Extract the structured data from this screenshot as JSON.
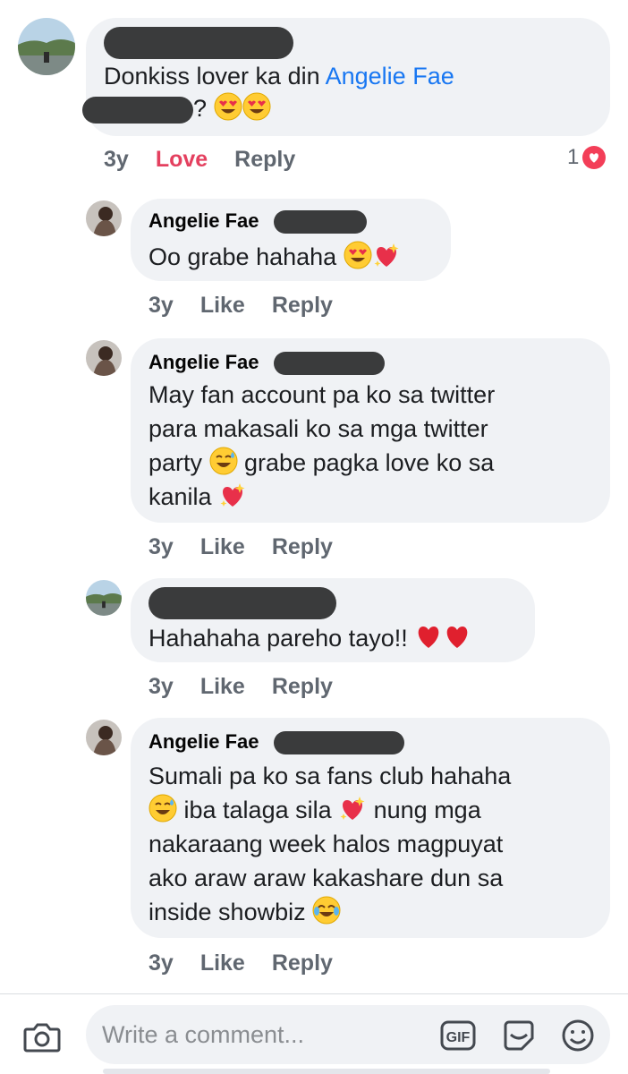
{
  "colors": {
    "bubble": "#f0f2f5",
    "love": "#e4405f",
    "link": "#1877f2",
    "meta": "#606770"
  },
  "composer": {
    "placeholder": "Write a comment...",
    "gif_label": "GIF"
  },
  "comments": [
    {
      "author": "",
      "text_line1_prefix": "Donkiss lover ka din ",
      "mention": "Angelie Fae",
      "text_line2_suffix": "? ",
      "emojis": [
        "heart-eyes",
        "heart-eyes"
      ],
      "time": "3y",
      "reaction_label": "Love",
      "reply_label": "Reply",
      "reaction_count": "1",
      "reaction_icon": "heart-icon"
    },
    {
      "author": "Angelie Fae",
      "lines": [
        "Oo grabe hahaha "
      ],
      "emojis": [
        "heart-eyes",
        "sparkling-heart"
      ],
      "time": "3y",
      "like_label": "Like",
      "reply_label": "Reply"
    },
    {
      "author": "Angelie Fae",
      "lines": [
        "May fan account pa ko sa twitter",
        "para makasali ko sa mga twitter",
        "party ",
        " grabe pagka love ko sa",
        "kanila "
      ],
      "time": "3y",
      "like_label": "Like",
      "reply_label": "Reply"
    },
    {
      "author": "",
      "lines": [
        "Hahahaha pareho tayo!! "
      ],
      "emojis": [
        "red-heart",
        "red-heart"
      ],
      "time": "3y",
      "like_label": "Like",
      "reply_label": "Reply"
    },
    {
      "author": "Angelie Fae",
      "lines": [
        "Sumali pa ko sa fans club hahaha",
        " iba talaga sila ",
        " nung mga",
        "nakaraang week halos magpuyat",
        "ako araw araw kakashare dun sa",
        "inside showbiz "
      ],
      "time": "3y",
      "like_label": "Like",
      "reply_label": "Reply"
    }
  ]
}
